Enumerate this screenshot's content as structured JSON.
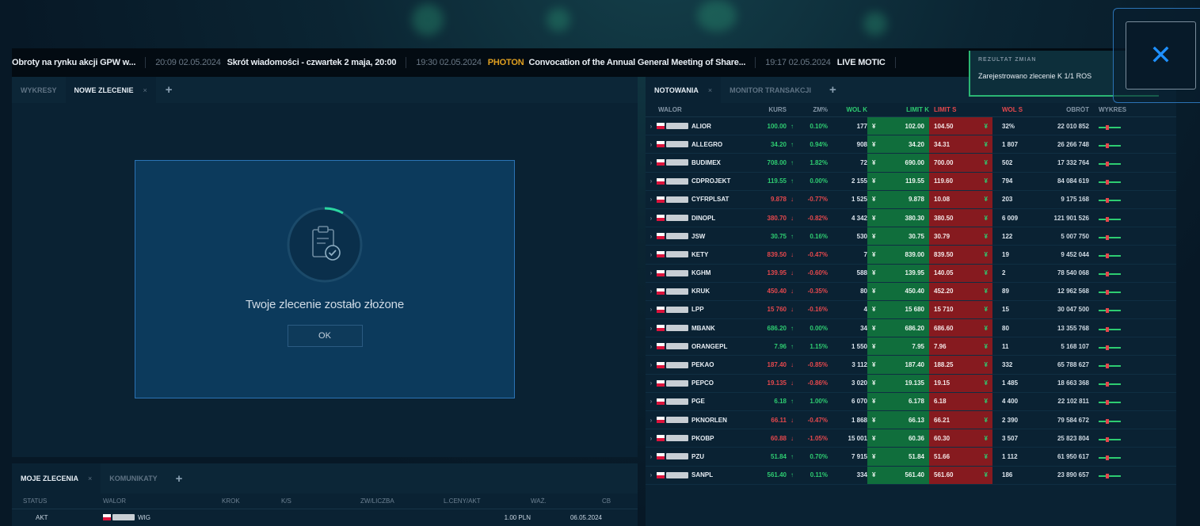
{
  "ticker": [
    {
      "time": "",
      "src": "",
      "text": "Obroty na rynku akcji GPW w..."
    },
    {
      "time": "20:09 02.05.2024",
      "src": "",
      "text": "Skrót wiadomości - czwartek 2 maja, 20:00"
    },
    {
      "time": "19:30 02.05.2024",
      "src": "PHOTON",
      "text": "Convocation of the Annual General Meeting of Share..."
    },
    {
      "time": "19:17 02.05.2024",
      "src": "",
      "text": "LIVE MOTIC"
    }
  ],
  "left_tabs": [
    {
      "label": "WYKRESY",
      "active": false
    },
    {
      "label": "NOWE ZLECENIE",
      "active": true
    }
  ],
  "modal": {
    "message": "Twoje zlecenie zostało złożone",
    "ok_label": "OK"
  },
  "bottom_tabs": [
    {
      "label": "MOJE ZLECENIA",
      "active": true
    },
    {
      "label": "KOMUNIKATY",
      "active": false
    }
  ],
  "bottom_headers": [
    "STATUS",
    "WALOR",
    "KROK",
    "K/S",
    "ZW/LICZBA",
    "L.CENY/AKT",
    "WAŻ.",
    "CB"
  ],
  "bottom_row": [
    "AKT",
    "WIG",
    "1.00 PLN",
    "06.05.2024"
  ],
  "right_tabs": [
    {
      "label": "NOTOWANIA",
      "active": true
    },
    {
      "label": "MONITOR TRANSAKCJI",
      "active": false
    }
  ],
  "quote_headers": [
    "WALOR",
    "KURS",
    "ZM%",
    "WOL K",
    "LIMIT K",
    "LIMIT S",
    "WOL S",
    "OBRÓT",
    "WYKRES"
  ],
  "quotes": [
    {
      "name": "ALIOR",
      "kurs": "100.00",
      "dir": "up",
      "chg": "0.10%",
      "vk": "177",
      "lk": "102.00",
      "ls": "104.50",
      "vs": "32%",
      "obrot": "22 010 852"
    },
    {
      "name": "ALLEGRO",
      "kurs": "34.20",
      "dir": "up",
      "chg": "0.94%",
      "vk": "908",
      "lk": "34.20",
      "ls": "34.31",
      "vs": "1 807",
      "obrot": "26 266 748"
    },
    {
      "name": "BUDIMEX",
      "kurs": "708.00",
      "dir": "up",
      "chg": "1.82%",
      "vk": "72",
      "lk": "690.00",
      "ls": "700.00",
      "vs": "502",
      "obrot": "17 332 764"
    },
    {
      "name": "CDPROJEKT",
      "kurs": "119.55",
      "dir": "up",
      "chg": "0.00%",
      "vk": "2 155",
      "lk": "119.55",
      "ls": "119.60",
      "vs": "794",
      "obrot": "84 084 619"
    },
    {
      "name": "CYFRPLSAT",
      "kurs": "9.878",
      "dir": "down",
      "chg": "-0.77%",
      "vk": "1 525",
      "lk": "9.878",
      "ls": "10.08",
      "vs": "203",
      "obrot": "9 175 168"
    },
    {
      "name": "DINOPL",
      "kurs": "380.70",
      "dir": "down",
      "chg": "-0.82%",
      "vk": "4 342",
      "lk": "380.30",
      "ls": "380.50",
      "vs": "6 009",
      "obrot": "121 901 526"
    },
    {
      "name": "JSW",
      "kurs": "30.75",
      "dir": "up",
      "chg": "0.16%",
      "vk": "530",
      "lk": "30.75",
      "ls": "30.79",
      "vs": "122",
      "obrot": "5 007 750"
    },
    {
      "name": "KETY",
      "kurs": "839.50",
      "dir": "down",
      "chg": "-0.47%",
      "vk": "7",
      "lk": "839.00",
      "ls": "839.50",
      "vs": "19",
      "obrot": "9 452 044"
    },
    {
      "name": "KGHM",
      "kurs": "139.95",
      "dir": "down",
      "chg": "-0.60%",
      "vk": "588",
      "lk": "139.95",
      "ls": "140.05",
      "vs": "2",
      "obrot": "78 540 068"
    },
    {
      "name": "KRUK",
      "kurs": "450.40",
      "dir": "down",
      "chg": "-0.35%",
      "vk": "80",
      "lk": "450.40",
      "ls": "452.20",
      "vs": "89",
      "obrot": "12 962 568"
    },
    {
      "name": "LPP",
      "kurs": "15 760",
      "dir": "down",
      "chg": "-0.16%",
      "vk": "4",
      "lk": "15 680",
      "ls": "15 710",
      "vs": "15",
      "obrot": "30 047 500"
    },
    {
      "name": "MBANK",
      "kurs": "686.20",
      "dir": "up",
      "chg": "0.00%",
      "vk": "34",
      "lk": "686.20",
      "ls": "686.60",
      "vs": "80",
      "obrot": "13 355 768"
    },
    {
      "name": "ORANGEPL",
      "kurs": "7.96",
      "dir": "up",
      "chg": "1.15%",
      "vk": "1 550",
      "lk": "7.95",
      "ls": "7.96",
      "vs": "11",
      "obrot": "5 168 107"
    },
    {
      "name": "PEKAO",
      "kurs": "187.40",
      "dir": "down",
      "chg": "-0.85%",
      "vk": "3 112",
      "lk": "187.40",
      "ls": "188.25",
      "vs": "332",
      "obrot": "65 788 627"
    },
    {
      "name": "PEPCO",
      "kurs": "19.135",
      "dir": "down",
      "chg": "-0.86%",
      "vk": "3 020",
      "lk": "19.135",
      "ls": "19.15",
      "vs": "1 485",
      "obrot": "18 663 368"
    },
    {
      "name": "PGE",
      "kurs": "6.18",
      "dir": "up",
      "chg": "1.00%",
      "vk": "6 070",
      "lk": "6.178",
      "ls": "6.18",
      "vs": "4 400",
      "obrot": "22 102 811"
    },
    {
      "name": "PKNORLEN",
      "kurs": "66.11",
      "dir": "down",
      "chg": "-0.47%",
      "vk": "1 868",
      "lk": "66.13",
      "ls": "66.21",
      "vs": "2 390",
      "obrot": "79 584 672"
    },
    {
      "name": "PKOBP",
      "kurs": "60.88",
      "dir": "down",
      "chg": "-1.05%",
      "vk": "15 001",
      "lk": "60.36",
      "ls": "60.30",
      "vs": "3 507",
      "obrot": "25 823 804"
    },
    {
      "name": "PZU",
      "kurs": "51.84",
      "dir": "up",
      "chg": "0.70%",
      "vk": "7 915",
      "lk": "51.84",
      "ls": "51.66",
      "vs": "1 112",
      "obrot": "61 950 617"
    },
    {
      "name": "SANPL",
      "kurs": "561.40",
      "dir": "up",
      "chg": "0.11%",
      "vk": "334",
      "lk": "561.40",
      "ls": "561.60",
      "vs": "186",
      "obrot": "23 890 657"
    }
  ],
  "notification": {
    "title": "REZULTAT ZMIAN",
    "body": "Zarejestrowano zlecenie K 1/1 ROS"
  },
  "colors": {
    "accent": "#1e90ff",
    "up": "#2ecc71",
    "down": "#e5484d",
    "bid_bg": "#106e3c",
    "ask_bg": "#861a1f"
  }
}
